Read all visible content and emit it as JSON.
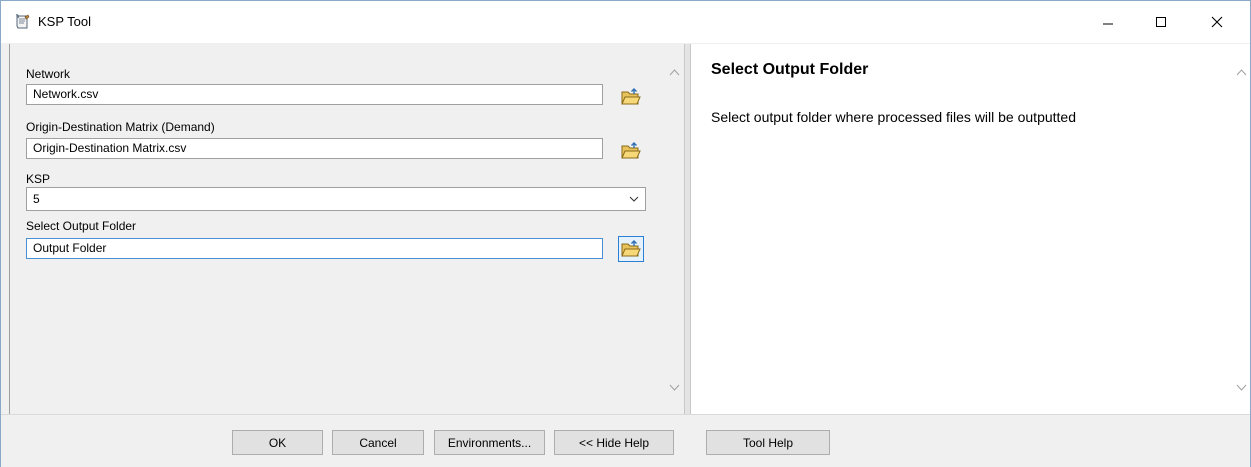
{
  "window": {
    "title": "KSP Tool",
    "icon": "script-tool-icon"
  },
  "form": {
    "network": {
      "label": "Network",
      "value": "Network.csv"
    },
    "od_matrix": {
      "label": "Origin-Destination Matrix (Demand)",
      "value": "Origin-Destination Matrix.csv"
    },
    "ksp": {
      "label": "KSP",
      "selected": "5"
    },
    "output": {
      "label": "Select Output Folder",
      "value": "Output Folder"
    }
  },
  "help": {
    "title": "Select Output Folder",
    "body": "Select output folder where processed files will be outputted"
  },
  "buttons": {
    "ok": "OK",
    "cancel": "Cancel",
    "environments": "Environments...",
    "hide_help": "<< Hide Help",
    "tool_help": "Tool Help"
  },
  "colors": {
    "focus_border": "#2b7fd4",
    "window_bg": "#f0f0f0"
  }
}
